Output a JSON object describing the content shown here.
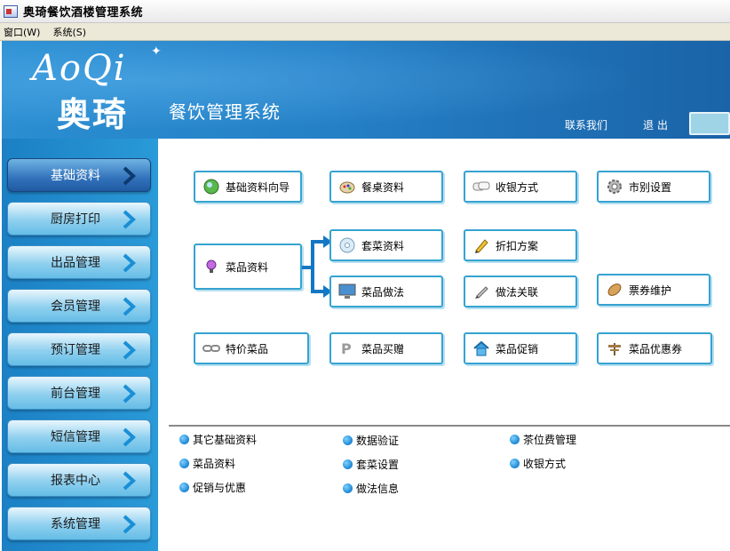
{
  "window": {
    "title": "奥琦餐饮酒楼管理系统"
  },
  "menubar": {
    "items": [
      "窗口(W)",
      "系统(S)"
    ]
  },
  "banner": {
    "logo_en": "AoQi",
    "logo_cn": "奥琦",
    "system_name": "餐饮管理系统",
    "contact_label": "联系我们",
    "exit_label": "退出"
  },
  "sidebar": {
    "items": [
      {
        "label": "基础资料",
        "active": true
      },
      {
        "label": "厨房打印",
        "active": false
      },
      {
        "label": "出品管理",
        "active": false
      },
      {
        "label": "会员管理",
        "active": false
      },
      {
        "label": "预订管理",
        "active": false
      },
      {
        "label": "前台管理",
        "active": false
      },
      {
        "label": "短信管理",
        "active": false
      },
      {
        "label": "报表中心",
        "active": false
      },
      {
        "label": "系统管理",
        "active": false
      }
    ]
  },
  "flow": {
    "basic_wizard": {
      "label": "基础资料向导",
      "icon": "globe-icon"
    },
    "table_info": {
      "label": "餐桌资料",
      "icon": "palette-icon"
    },
    "payment_methods": {
      "label": "收银方式",
      "icon": "cards-icon"
    },
    "currency_settings": {
      "label": "市别设置",
      "icon": "gear-icon"
    },
    "dish_info": {
      "label": "菜品资料",
      "icon": "lightbulb-icon"
    },
    "set_meal_info": {
      "label": "套菜资料",
      "icon": "cd-icon"
    },
    "discount_plan": {
      "label": "折扣方案",
      "icon": "pencil-icon"
    },
    "dish_method": {
      "label": "菜品做法",
      "icon": "monitor-icon"
    },
    "method_link": {
      "label": "做法关联",
      "icon": "pen-icon"
    },
    "voucher_maintenance": {
      "label": "票券维护",
      "icon": "bread-icon"
    },
    "special_dish": {
      "label": "特价菜品",
      "icon": "chain-icon"
    },
    "dish_gift": {
      "label": "菜品买赠",
      "icon": "paypal-icon"
    },
    "dish_promotion": {
      "label": "菜品促销",
      "icon": "home-icon"
    },
    "dish_coupon": {
      "label": "菜品优惠券",
      "icon": "signpost-icon"
    }
  },
  "links": {
    "col1": [
      "其它基础资料",
      "菜品资料",
      "促销与优惠"
    ],
    "col2": [
      "数据验证",
      "套菜设置",
      "做法信息"
    ],
    "col3": [
      "茶位费管理",
      "收银方式"
    ]
  },
  "colors": {
    "accent": "#2580c6",
    "button_border": "#35a3d1",
    "arrow": "#1477c4"
  }
}
